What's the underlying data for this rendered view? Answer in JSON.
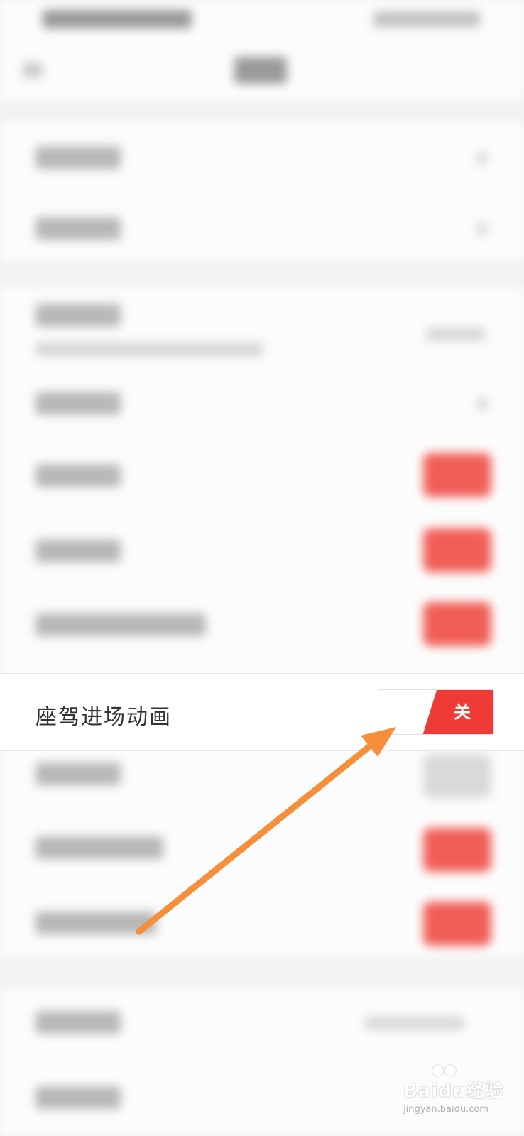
{
  "setting_row": {
    "label": "座驾进场动画",
    "toggle": {
      "state": "off",
      "label": "关"
    }
  },
  "annotation": {
    "arrow": "orange-arrow"
  },
  "watermark": {
    "brand": "Baidu经验",
    "url": "jingyan.baidu.com"
  },
  "colors": {
    "toggle_active": "#ef3b35",
    "arrow": "#f58f3c",
    "background": "#f2f2f2"
  },
  "icons": [
    "back-arrow-icon",
    "chevron-right-icon",
    "paw-logo-icon"
  ]
}
